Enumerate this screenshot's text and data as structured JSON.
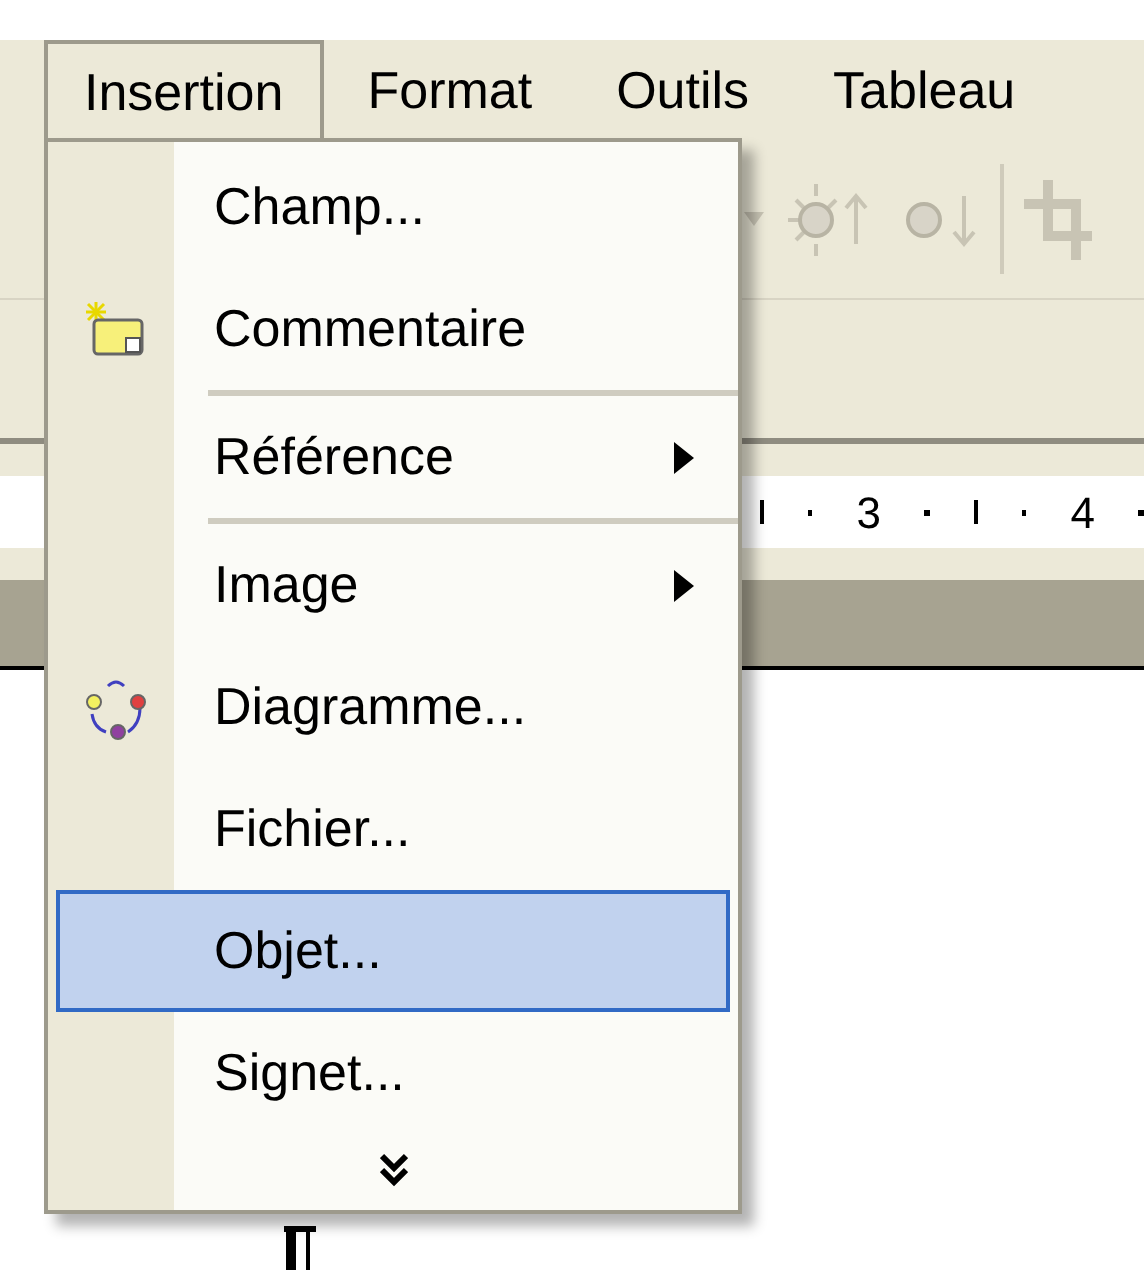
{
  "menu_bar": [
    {
      "label": "Insertion",
      "selected": true
    },
    {
      "label": "Format",
      "selected": false
    },
    {
      "label": "Outils",
      "selected": false
    },
    {
      "label": "Tableau",
      "selected": false
    }
  ],
  "ruler_labels": [
    "3",
    "4"
  ],
  "menu": [
    {
      "kind": "item",
      "label": "Champ...",
      "submenu": false,
      "selected": false
    },
    {
      "kind": "item",
      "label": "Commentaire",
      "submenu": false,
      "selected": false
    },
    {
      "kind": "separator"
    },
    {
      "kind": "item",
      "label": "Référence",
      "submenu": true,
      "selected": false
    },
    {
      "kind": "separator"
    },
    {
      "kind": "item",
      "label": "Image",
      "submenu": true,
      "selected": false
    },
    {
      "kind": "item",
      "label": "Diagramme...",
      "submenu": false,
      "selected": false
    },
    {
      "kind": "item",
      "label": "Fichier...",
      "submenu": false,
      "selected": false
    },
    {
      "kind": "item",
      "label": "Objet...",
      "submenu": false,
      "selected": true
    },
    {
      "kind": "item",
      "label": "Signet...",
      "submenu": false,
      "selected": false
    },
    {
      "kind": "expand"
    }
  ]
}
